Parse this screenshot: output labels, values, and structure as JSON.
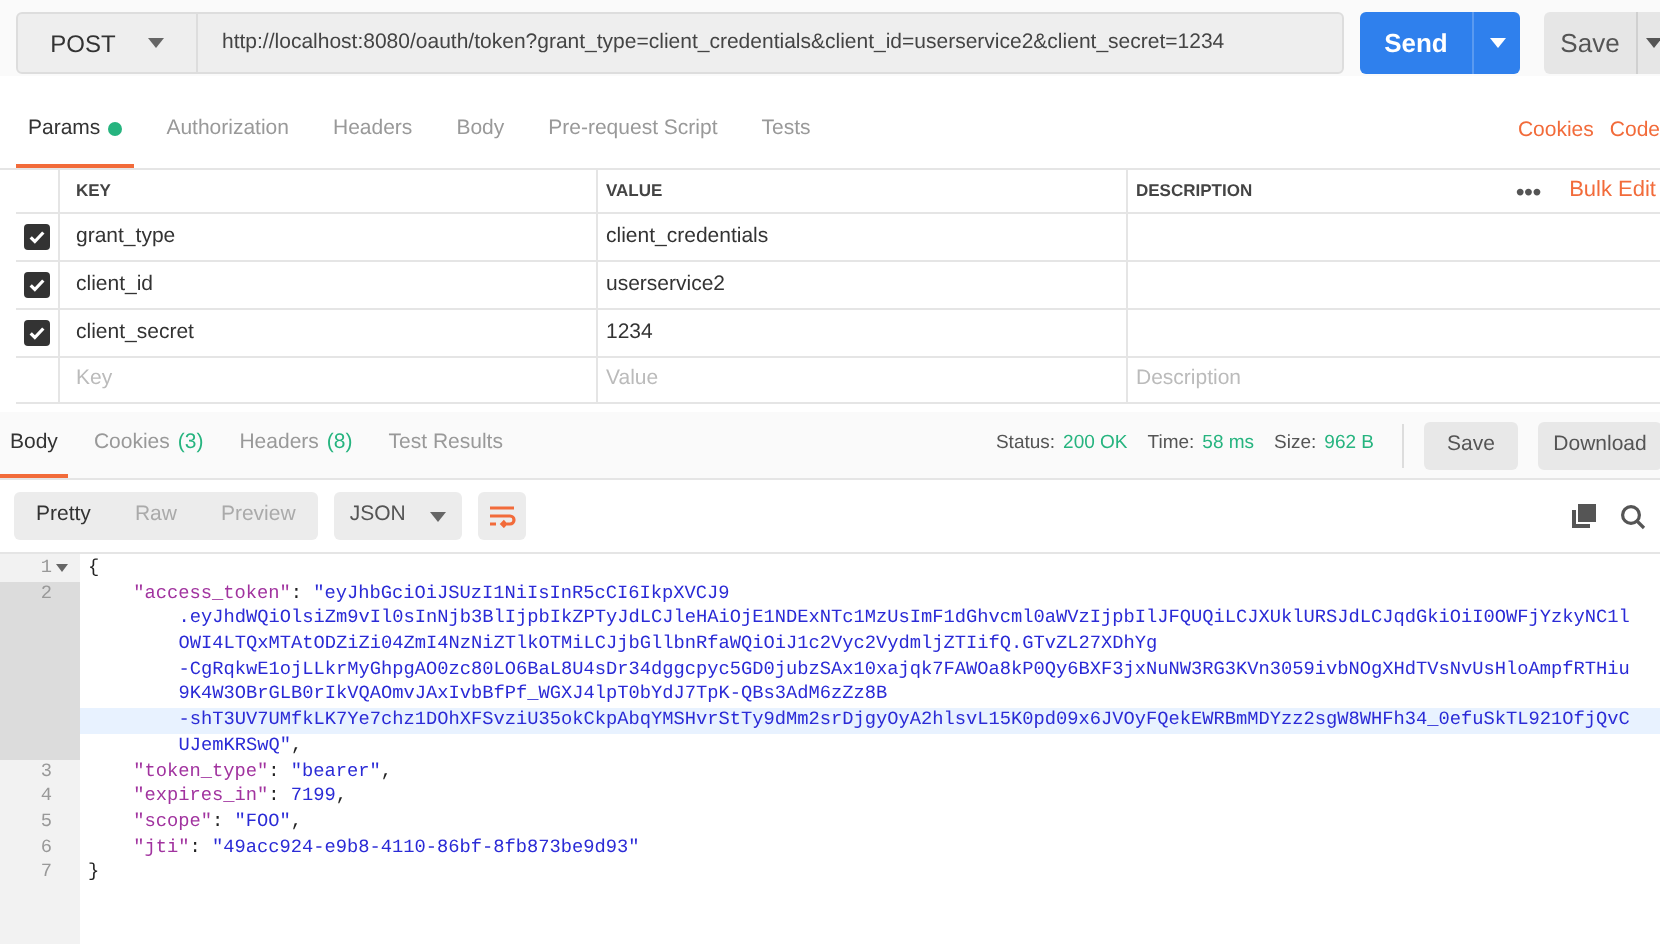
{
  "request": {
    "method": "POST",
    "url": "http://localhost:8080/oauth/token?grant_type=client_credentials&client_id=userservice2&client_secret=1234",
    "send": "Send",
    "save": "Save"
  },
  "request_tabs": [
    {
      "label": "Params",
      "selected": true,
      "dot": true
    },
    {
      "label": "Authorization",
      "selected": false,
      "dot": false
    },
    {
      "label": "Headers",
      "selected": false,
      "dot": false
    },
    {
      "label": "Body",
      "selected": false,
      "dot": false
    },
    {
      "label": "Pre-request Script",
      "selected": false,
      "dot": false
    },
    {
      "label": "Tests",
      "selected": false,
      "dot": false
    }
  ],
  "request_links": [
    "Cookies",
    "Code"
  ],
  "params": {
    "columns": [
      "KEY",
      "VALUE",
      "DESCRIPTION"
    ],
    "more": "•••",
    "bulk_edit": "Bulk Edit",
    "rows": [
      {
        "checked": true,
        "key": "grant_type",
        "value": "client_credentials"
      },
      {
        "checked": true,
        "key": "client_id",
        "value": "userservice2"
      },
      {
        "checked": true,
        "key": "client_secret",
        "value": "1234"
      }
    ],
    "new_row": [
      {
        "placeholder": "Key"
      },
      {
        "placeholder": "Value"
      },
      {
        "placeholder": "Description"
      }
    ]
  },
  "response_tabs": [
    {
      "label": "Body",
      "selected": true
    },
    {
      "label": "Cookies",
      "count": "(3)",
      "selected": false
    },
    {
      "label": "Headers",
      "count": "(8)",
      "selected": false
    },
    {
      "label": "Test Results",
      "selected": false
    }
  ],
  "status": [
    {
      "label": "Status:",
      "value": "200 OK"
    },
    {
      "label": "Time:",
      "value": "58 ms"
    },
    {
      "label": "Size:",
      "value": "962 B"
    }
  ],
  "response_buttons": [
    "Save",
    "Download"
  ],
  "view_modes": [
    {
      "label": "Pretty",
      "selected": true
    },
    {
      "label": "Raw",
      "selected": false
    },
    {
      "label": "Preview",
      "selected": false
    }
  ],
  "format": "JSON",
  "wrap_on": true,
  "code_lines": [
    {
      "number": "1",
      "fold": true,
      "selected": false,
      "indented": false,
      "rows": [
        {
          "highlighted": false,
          "parts": [
            {
              "kind": "punct",
              "text": "{"
            }
          ]
        }
      ]
    },
    {
      "number": "2",
      "fold": false,
      "selected": true,
      "indented": true,
      "rows": [
        {
          "highlighted": false,
          "parts": [
            {
              "kind": "key",
              "text": "\"access_token\""
            },
            {
              "kind": "punct",
              "text": ": "
            },
            {
              "kind": "string",
              "text": "\"eyJhbGciOiJSUzI1NiIsInR5cCI6IkpXVCJ9"
            }
          ]
        },
        {
          "highlighted": false,
          "parts": [
            {
              "kind": "string",
              "text": ".eyJhdWQiOlsiZm9vIl0sInNjb3BlIjpbIkZPTyJdLCJleHAiOjE1NDExNTc1MzUsImF1dGhvcml0aWVzIjpbIlJFQUQiLCJXUklURSJdLCJqdGkiOiI0OWFjYzkyNC1l"
            }
          ]
        },
        {
          "highlighted": false,
          "parts": [
            {
              "kind": "string",
              "text": "OWI4LTQxMTAtODZiZi04ZmI4NzNiZTlkOTMiLCJjbGllbnRfaWQiOiJ1c2Vyc2VydmljZTIifQ.GTvZL27XDhYg"
            }
          ]
        },
        {
          "highlighted": false,
          "parts": [
            {
              "kind": "string",
              "text": "-CgRqkwE1ojLLkrMyGhpgAO0zc80LO6BaL8U4sDr34dggcpyc5GD0jubzSAx10xajqk7FAWOa8kP0Qy6BXF3jxNuNW3RG3KVn3059ivbNOgXHdTVsNvUsHloAmpfRTHiu"
            }
          ]
        },
        {
          "highlighted": false,
          "parts": [
            {
              "kind": "string",
              "text": "9K4W3OBrGLB0rIkVQAOmvJAxIvbBfPf_WGXJ4lpT0bYdJ7TpK-QBs3AdM6zZz8B"
            }
          ]
        },
        {
          "highlighted": true,
          "parts": [
            {
              "kind": "string",
              "text": "-shT3UV7UMfkLK7Ye7chz1DOhXFSvziU35okCkpAbqYMSHvrStTy9dMm2srDjgyOyA2hlsvL15K0pd09x6JVOyFQekEWRBmMDYzz2sgW8WHFh34_0efuSkTL921OfjQvC"
            }
          ]
        },
        {
          "highlighted": false,
          "parts": [
            {
              "kind": "string",
              "text": "UJemKRSwQ\""
            },
            {
              "kind": "punct",
              "text": ","
            }
          ]
        }
      ]
    },
    {
      "number": "3",
      "fold": false,
      "selected": false,
      "indented": true,
      "rows": [
        {
          "highlighted": false,
          "parts": [
            {
              "kind": "key",
              "text": "\"token_type\""
            },
            {
              "kind": "punct",
              "text": ": "
            },
            {
              "kind": "string",
              "text": "\"bearer\""
            },
            {
              "kind": "punct",
              "text": ","
            }
          ]
        }
      ]
    },
    {
      "number": "4",
      "fold": false,
      "selected": false,
      "indented": true,
      "rows": [
        {
          "highlighted": false,
          "parts": [
            {
              "kind": "key",
              "text": "\"expires_in\""
            },
            {
              "kind": "punct",
              "text": ": "
            },
            {
              "kind": "number",
              "text": "7199"
            },
            {
              "kind": "punct",
              "text": ","
            }
          ]
        }
      ]
    },
    {
      "number": "5",
      "fold": false,
      "selected": false,
      "indented": true,
      "rows": [
        {
          "highlighted": false,
          "parts": [
            {
              "kind": "key",
              "text": "\"scope\""
            },
            {
              "kind": "punct",
              "text": ": "
            },
            {
              "kind": "string",
              "text": "\"FOO\""
            },
            {
              "kind": "punct",
              "text": ","
            }
          ]
        }
      ]
    },
    {
      "number": "6",
      "fold": false,
      "selected": false,
      "indented": true,
      "rows": [
        {
          "highlighted": false,
          "parts": [
            {
              "kind": "key",
              "text": "\"jti\""
            },
            {
              "kind": "punct",
              "text": ": "
            },
            {
              "kind": "string",
              "text": "\"49acc924-e9b8-4110-86bf-8fb873be9d93\""
            }
          ]
        }
      ]
    },
    {
      "number": "7",
      "fold": false,
      "selected": false,
      "indented": false,
      "rows": [
        {
          "highlighted": false,
          "parts": [
            {
              "kind": "punct",
              "text": "}"
            }
          ]
        }
      ]
    }
  ]
}
